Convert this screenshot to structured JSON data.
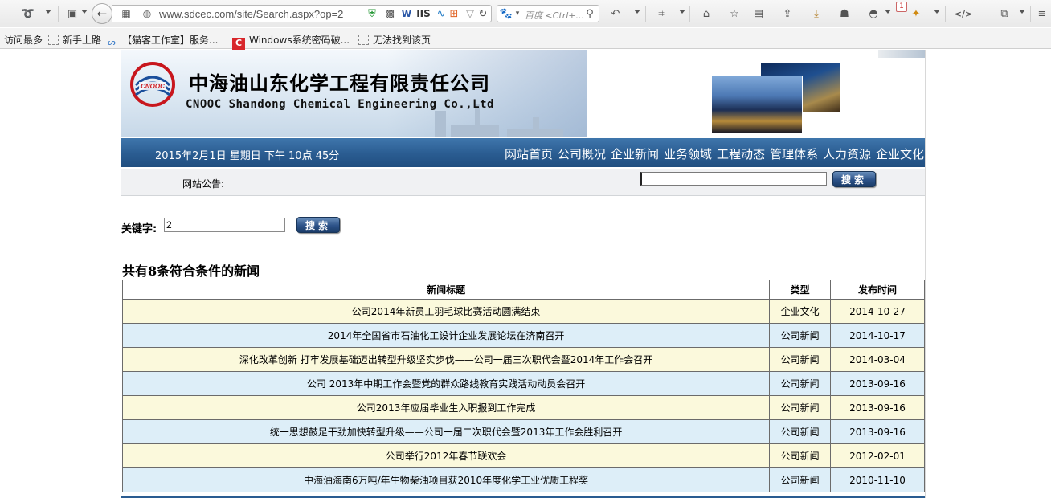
{
  "browser": {
    "url": "www.sdcec.com/site/Search.aspx?op=2",
    "search_placeholder": "百度 <Ctrl+...",
    "notification_count": "1",
    "bookmarks": [
      {
        "label": "访问最多"
      },
      {
        "label": "新手上路"
      },
      {
        "label": "【猫客工作室】服务..."
      },
      {
        "label": "Windows系统密码破..."
      },
      {
        "label": "无法找到该页"
      }
    ]
  },
  "site": {
    "company_cn": "中海油山东化学工程有限责任公司",
    "company_en": "CNOOC Shandong Chemical Engineering Co.,Ltd",
    "datetime": "2015年2月1日 星期日 下午 10点 45分",
    "nav": [
      "网站首页",
      "公司概况",
      "企业新闻",
      "业务领域",
      "工程动态",
      "管理体系",
      "人力资源",
      "企业文化"
    ],
    "notice_label": "网站公告:",
    "top_search_value": "",
    "search_button": "搜索"
  },
  "search": {
    "keyword_label": "关键字:",
    "keyword_value": "2",
    "button": "搜索"
  },
  "results": {
    "summary": "共有8条符合条件的新闻",
    "headers": [
      "新闻标题",
      "类型",
      "发布时间"
    ],
    "rows": [
      {
        "title": "公司2014年新员工羽毛球比赛活动圆满结束",
        "type": "企业文化",
        "date": "2014-10-27"
      },
      {
        "title": "2014年全国省市石油化工设计企业发展论坛在济南召开",
        "type": "公司新闻",
        "date": "2014-10-17"
      },
      {
        "title": "深化改革创新 打牢发展基础迈出转型升级坚实步伐——公司一届三次职代会暨2014年工作会召开",
        "type": "公司新闻",
        "date": "2014-03-04"
      },
      {
        "title": "公司 2013年中期工作会暨党的群众路线教育实践活动动员会召开",
        "type": "公司新闻",
        "date": "2013-09-16"
      },
      {
        "title": "公司2013年应届毕业生入职报到工作完成",
        "type": "公司新闻",
        "date": "2013-09-16"
      },
      {
        "title": "统一思想鼓足干劲加快转型升级——公司一届二次职代会暨2013年工作会胜利召开",
        "type": "公司新闻",
        "date": "2013-09-16"
      },
      {
        "title": "公司举行2012年春节联欢会",
        "type": "公司新闻",
        "date": "2012-02-01"
      },
      {
        "title": "中海油海南6万吨/年生物柴油项目获2010年度化学工业优质工程奖",
        "type": "公司新闻",
        "date": "2010-11-10"
      }
    ]
  },
  "colors": {
    "nav_blue": "#2a5c91",
    "row_odd": "#fbf9dc",
    "row_even": "#ddeef8",
    "logo_red": "#c8161d",
    "logo_blue": "#1b4f9c"
  }
}
